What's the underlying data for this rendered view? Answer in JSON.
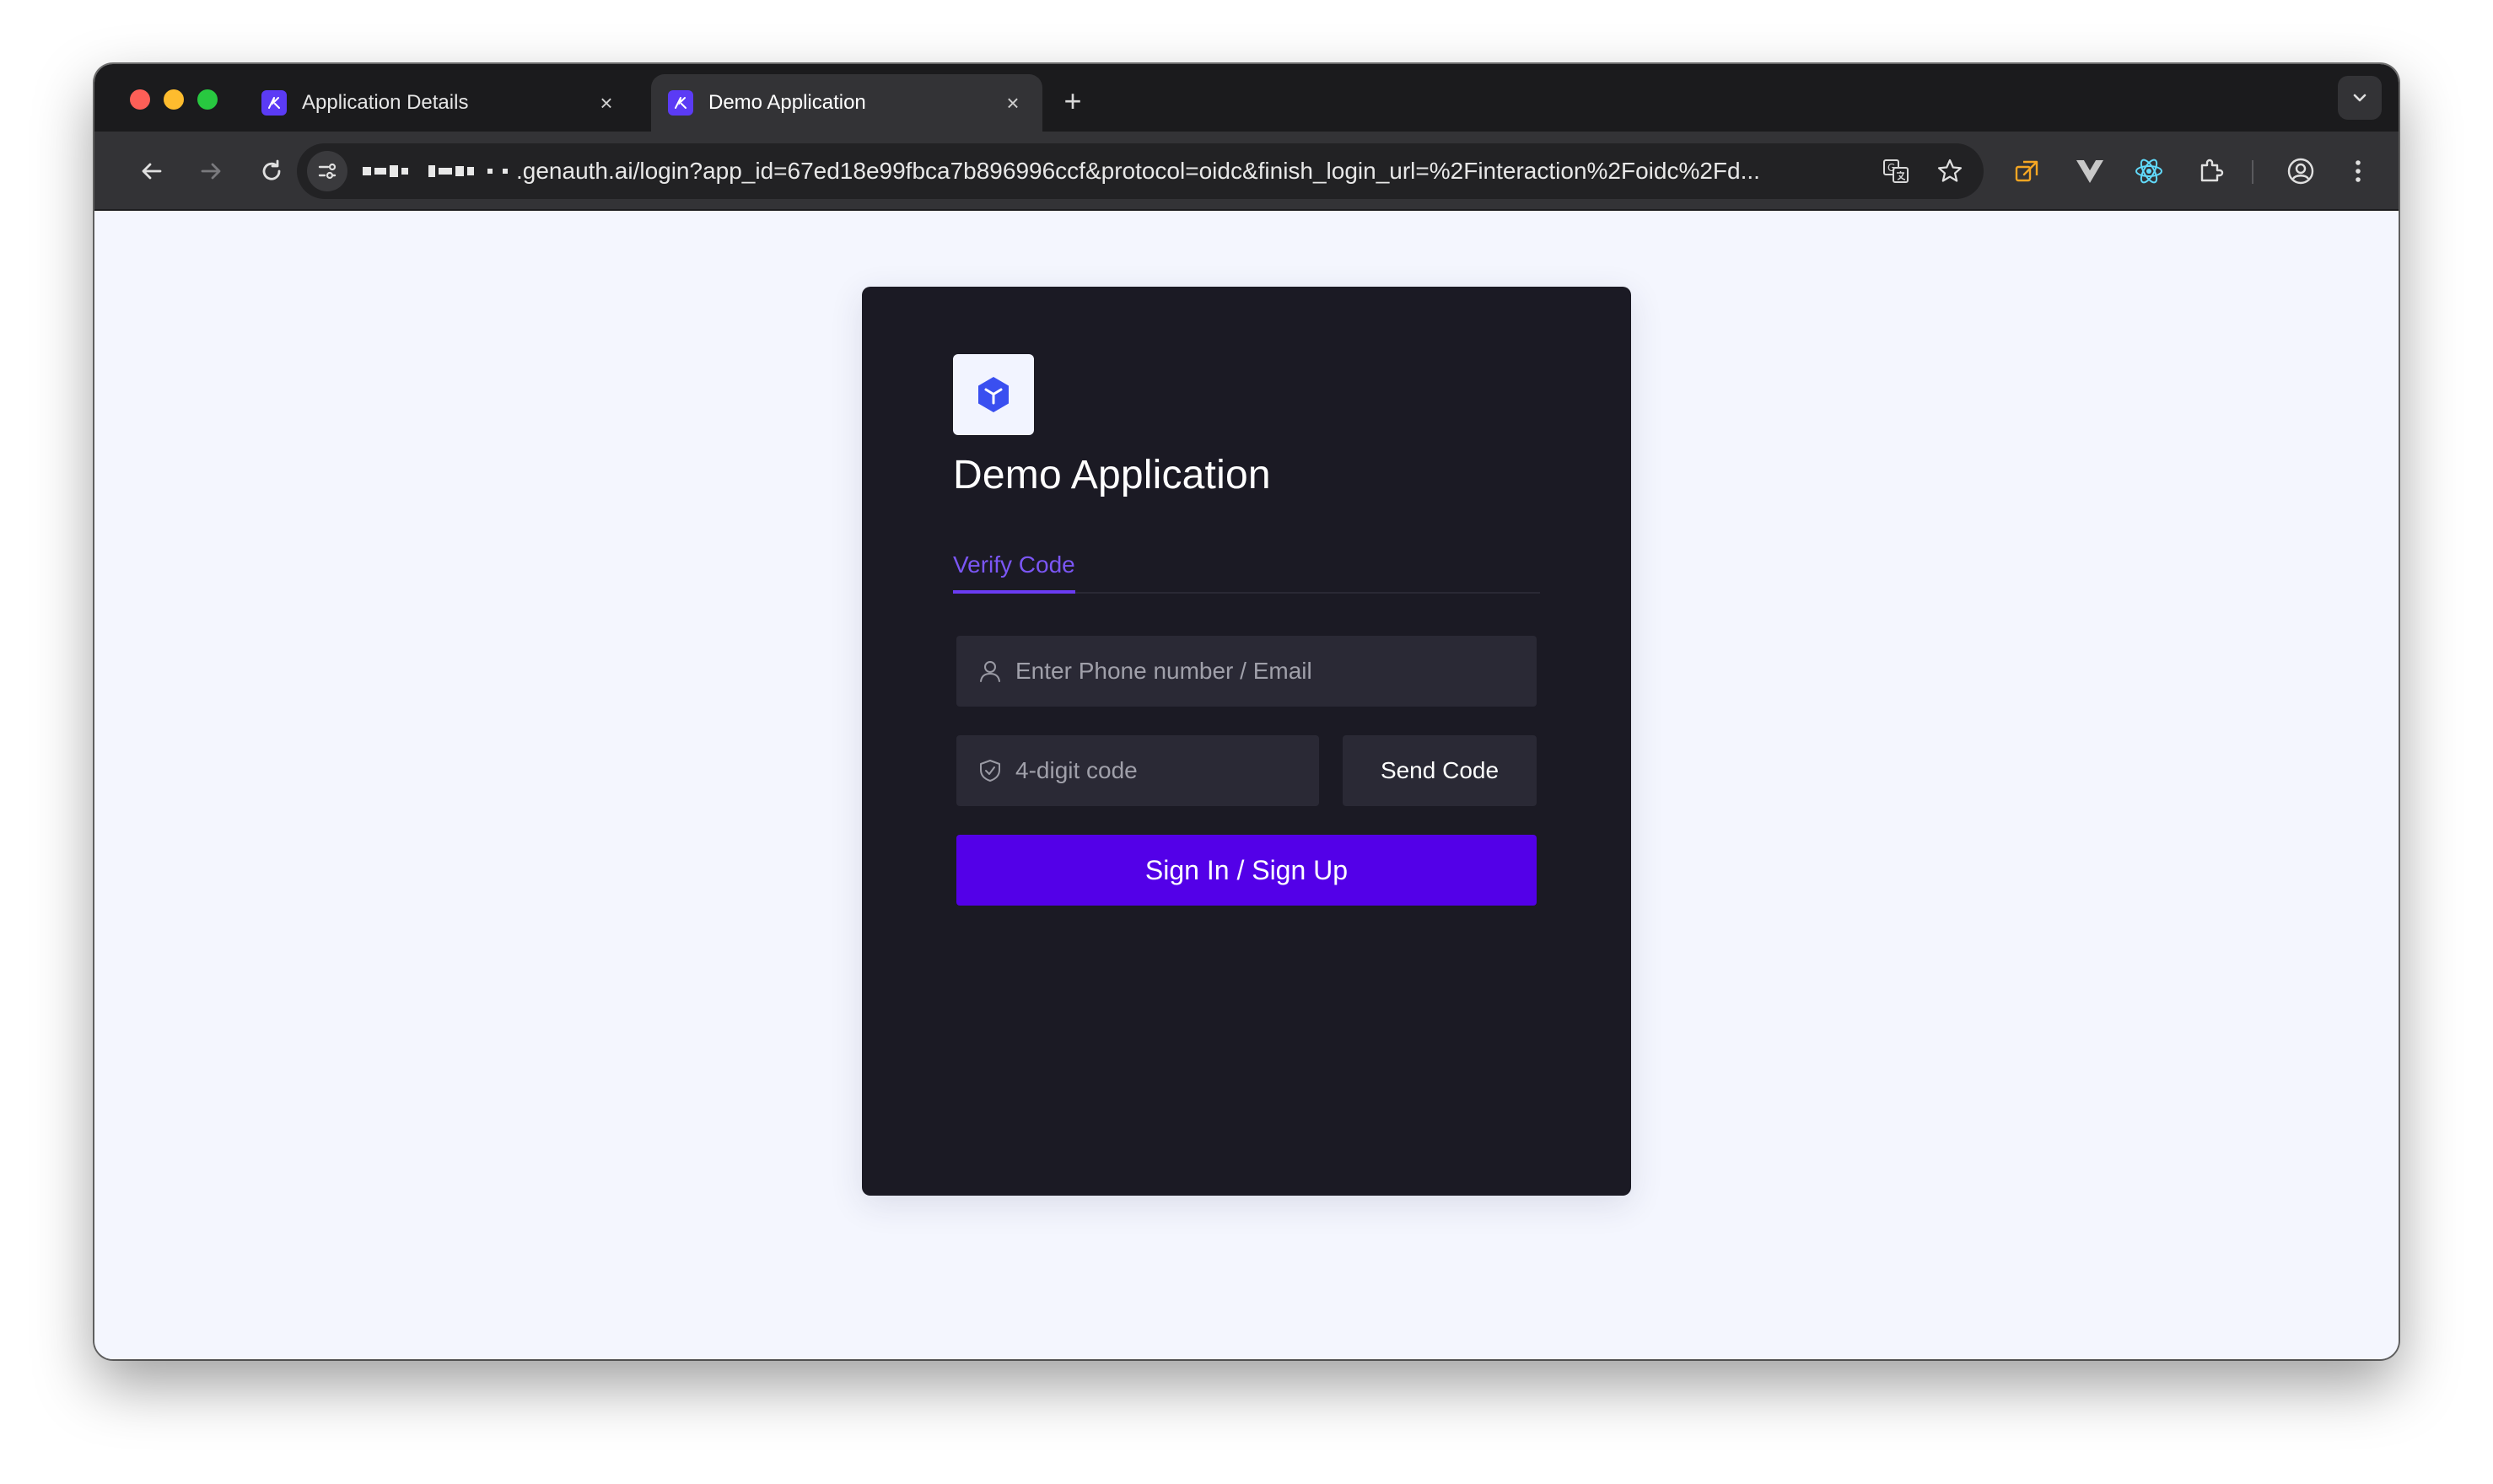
{
  "browser": {
    "tabs": [
      {
        "title": "Application Details",
        "active": false
      },
      {
        "title": "Demo Application",
        "active": true
      }
    ],
    "new_tab_glyph": "+",
    "close_glyph": "×",
    "address_bar": {
      "url_text": ".genauth.ai/login?app_id=67ed18e99fbca7b896996ccf&protocol=oidc&finish_login_url=%2Finteraction%2Foidc%2Fd..."
    },
    "toolbar_icons": [
      "back-arrow-icon",
      "forward-arrow-icon",
      "reload-icon",
      "site-info-icon",
      "translate-icon",
      "star-icon",
      "copy-extension-icon",
      "vue-devtools-icon",
      "react-devtools-icon",
      "puzzle-extensions-icon",
      "profile-icon",
      "more-menu-icon"
    ]
  },
  "login": {
    "app_title": "Demo Application",
    "tab_label": "Verify Code",
    "account_placeholder": "Enter Phone number / Email",
    "code_placeholder": "4-digit code",
    "send_code_label": "Send Code",
    "submit_label": "Sign In / Sign Up"
  },
  "colors": {
    "accent": "#5300e8",
    "tab_accent": "#7b56f5",
    "card_background": "#1b1a24",
    "field_background": "#2a2935",
    "page_background": "#f4f6fe",
    "logo_cube": "#3a4ff0"
  }
}
